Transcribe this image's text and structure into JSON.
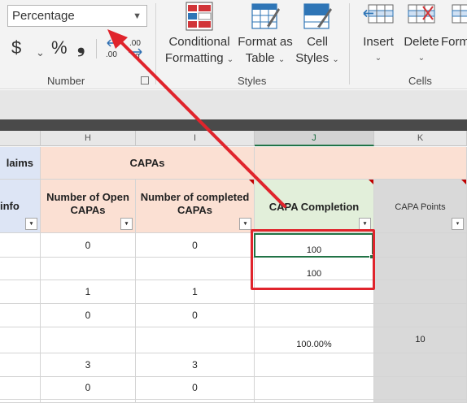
{
  "ribbon": {
    "number_format": "Percentage",
    "currency_symbol": "$",
    "percent_symbol": "%",
    "comma_symbol": "❟",
    "increase_decimal_top": ".0",
    "increase_decimal_bottom": ".00",
    "decrease_decimal_top": ".00",
    "decrease_decimal_bottom": "→.0",
    "number_group_label": "Number",
    "conditional_formatting_line1": "Conditional",
    "conditional_formatting_line2": "Formatting",
    "format_as_table_line1": "Format as",
    "format_as_table_line2": "Table",
    "cell_styles_line1": "Cell",
    "cell_styles_line2": "Styles",
    "styles_group_label": "Styles",
    "insert_label": "Insert",
    "delete_label": "Delete",
    "format_label": "Form",
    "cells_group_label": "Cells",
    "chevron": "⌄"
  },
  "columns": [
    "H",
    "I",
    "J",
    "K"
  ],
  "sheet": {
    "claims_fragment": "laims",
    "capas_header": "CAPAs",
    "info_fragment": "info",
    "col_h_header": "Number of Open CAPAs",
    "col_i_header": "Number of completed CAPAs",
    "col_j_header": "CAPA Completion",
    "col_k_header": "CAPA Points",
    "filter_glyph": "▾",
    "rows": [
      {
        "h": "0",
        "i": "0",
        "j": "100",
        "k": ""
      },
      {
        "h": "",
        "i": "",
        "j": "100",
        "k": ""
      },
      {
        "h": "1",
        "i": "1",
        "j": "",
        "k": ""
      },
      {
        "h": "0",
        "i": "0",
        "j": "",
        "k": ""
      },
      {
        "h": "",
        "i": "",
        "j": "100.00%",
        "k": "10"
      },
      {
        "h": "3",
        "i": "3",
        "j": "",
        "k": ""
      },
      {
        "h": "0",
        "i": "0",
        "j": "",
        "k": ""
      }
    ]
  },
  "colors": {
    "selection_green": "#217346",
    "annotation_red": "#e0242c",
    "header_orange": "#fbe0d3",
    "header_green": "#e2efda",
    "header_blue": "#dde5f5",
    "grey_column": "#d9d9d9"
  }
}
